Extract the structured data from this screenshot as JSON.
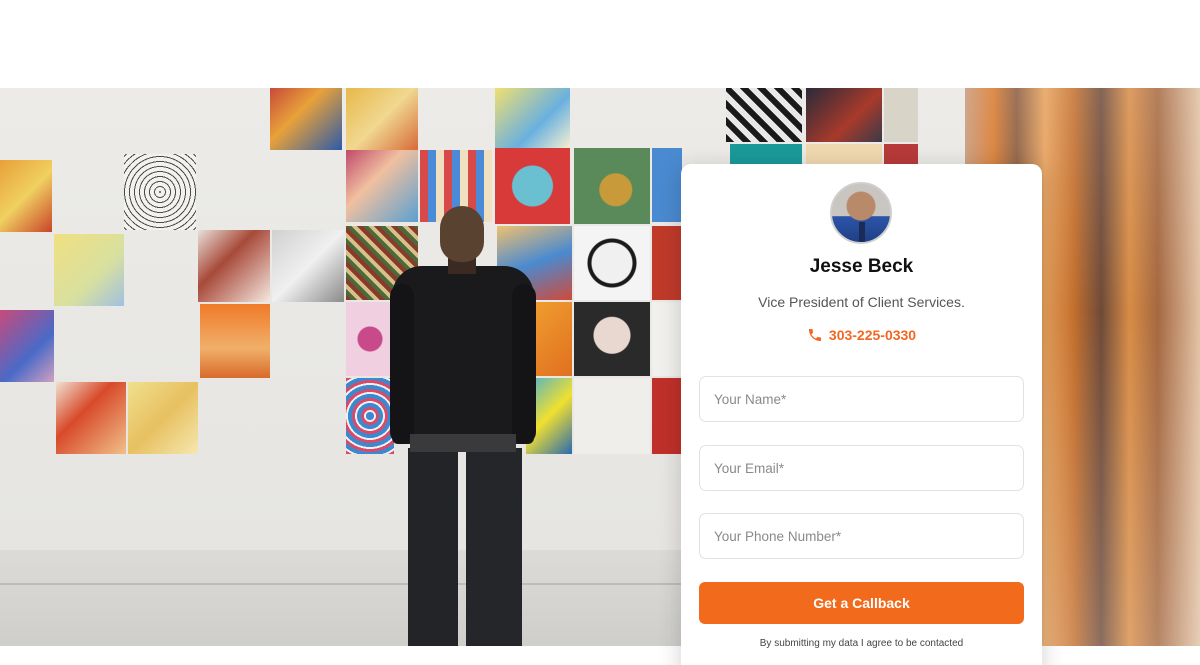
{
  "contact_card": {
    "name": "Jesse Beck",
    "title": "Vice President of Client Services.",
    "phone": "303-225-0330",
    "accent_color": "#f26a1b"
  },
  "form": {
    "name_placeholder": "Your Name*",
    "email_placeholder": "Your Email*",
    "phone_placeholder": "Your Phone Number*",
    "submit_label": "Get a Callback",
    "consent_text": "By submitting my data I agree to be contacted"
  },
  "icons": {
    "phone": "phone-icon",
    "avatar": "avatar"
  }
}
